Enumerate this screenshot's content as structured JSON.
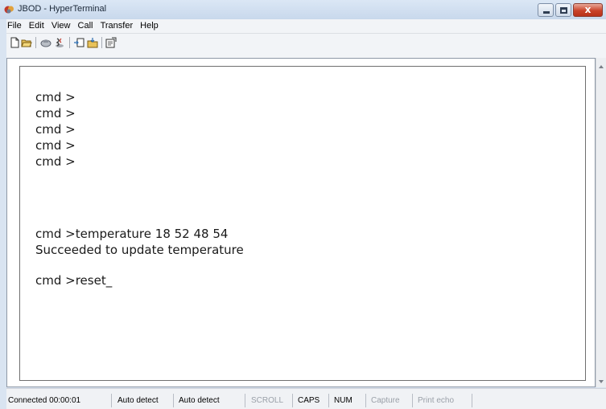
{
  "window": {
    "title": "JBOD - HyperTerminal",
    "close_label": "x"
  },
  "menu": {
    "items": [
      "File",
      "Edit",
      "View",
      "Call",
      "Transfer",
      "Help"
    ]
  },
  "toolbar": {
    "icons": [
      "new-document-icon",
      "open-folder-icon",
      "connect-phone-icon",
      "disconnect-icon",
      "send-file-icon",
      "receive-file-icon",
      "properties-icon"
    ]
  },
  "terminal": {
    "lines": [
      "cmd >",
      "cmd >",
      "cmd >",
      "cmd >",
      "cmd >",
      "cmd >temperature 18 52 48 54",
      "Succeeded to update temperature",
      "cmd >reset_"
    ]
  },
  "status": {
    "connected": "Connected 00:00:01",
    "detect1": "Auto detect",
    "detect2": "Auto detect",
    "scroll": "SCROLL",
    "caps": "CAPS",
    "num": "NUM",
    "capture": "Capture",
    "print_echo": "Print echo"
  }
}
